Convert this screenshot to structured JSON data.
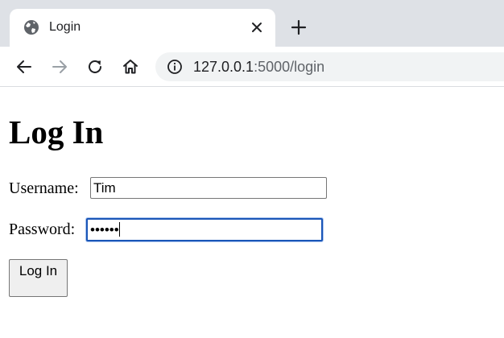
{
  "browser": {
    "tab": {
      "title": "Login",
      "favicon": "globe-icon",
      "close_icon": "close-icon"
    },
    "new_tab_icon": "plus-icon",
    "nav": {
      "back_icon": "arrow-left-icon",
      "forward_icon": "arrow-right-icon",
      "reload_icon": "reload-icon",
      "home_icon": "home-icon"
    },
    "address_bar": {
      "info_icon": "info-icon",
      "url_host": "127.0.0.1",
      "url_path": ":5000/login"
    }
  },
  "page": {
    "title": "Log In",
    "username": {
      "label": "Username:",
      "value": "Tim"
    },
    "password": {
      "label": "Password:",
      "masked_value": "••••••"
    },
    "submit_label": "Log In"
  },
  "colors": {
    "tabstrip_bg": "#dee1e6",
    "omnibox_bg": "#f1f3f4",
    "focus_ring": "#1a56b8"
  }
}
